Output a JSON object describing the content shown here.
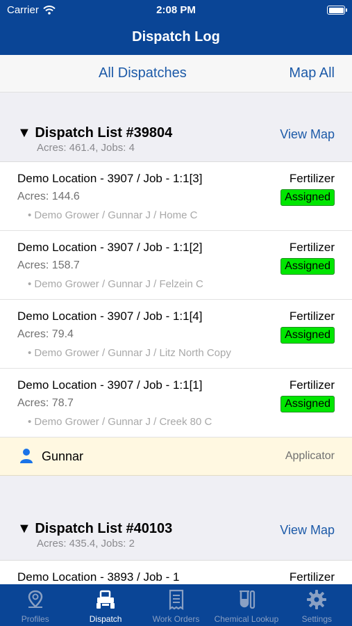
{
  "status": {
    "carrier": "Carrier",
    "time": "2:08 PM"
  },
  "nav": {
    "title": "Dispatch Log"
  },
  "toolbar": {
    "all_dispatches": "All Dispatches",
    "map_all": "Map All"
  },
  "sections": [
    {
      "title": "▼ Dispatch List #39804",
      "summary": "Acres: 461.4, Jobs: 4",
      "view_map": "View Map",
      "jobs": [
        {
          "name": "Demo Location - 3907 / Job - 1:1[3]",
          "acres": "Acres: 144.6",
          "path": "• Demo Grower / Gunnar J / Home C",
          "type": "Fertilizer",
          "status": "Assigned"
        },
        {
          "name": "Demo Location - 3907 / Job - 1:1[2]",
          "acres": "Acres: 158.7",
          "path": "• Demo Grower / Gunnar J / Felzein C",
          "type": "Fertilizer",
          "status": "Assigned"
        },
        {
          "name": "Demo Location - 3907 / Job - 1:1[4]",
          "acres": "Acres: 79.4",
          "path": "• Demo Grower / Gunnar J / Litz North Copy",
          "type": "Fertilizer",
          "status": "Assigned"
        },
        {
          "name": "Demo Location - 3907 / Job - 1:1[1]",
          "acres": "Acres: 78.7",
          "path": "• Demo Grower / Gunnar J / Creek 80 C",
          "type": "Fertilizer",
          "status": "Assigned"
        }
      ],
      "applicator": {
        "name": "Gunnar",
        "role": "Applicator"
      }
    },
    {
      "title": "▼ Dispatch List #40103",
      "summary": "Acres: 435.4, Jobs: 2",
      "view_map": "View Map",
      "jobs": [
        {
          "name": "Demo Location - 3893 / Job - 1",
          "type": "Fertilizer"
        }
      ]
    }
  ],
  "tabs": [
    {
      "label": "Profiles",
      "icon": "map-pin-icon",
      "active": false
    },
    {
      "label": "Dispatch",
      "icon": "tractor-icon",
      "active": true
    },
    {
      "label": "Work Orders",
      "icon": "receipt-icon",
      "active": false
    },
    {
      "label": "Chemical Lookup",
      "icon": "flask-icon",
      "active": false
    },
    {
      "label": "Settings",
      "icon": "gear-icon",
      "active": false
    }
  ],
  "colors": {
    "brand": "#0a4596",
    "link": "#1c5aa8",
    "assigned": "#00e600",
    "applicator_bg": "#fff8e1"
  }
}
